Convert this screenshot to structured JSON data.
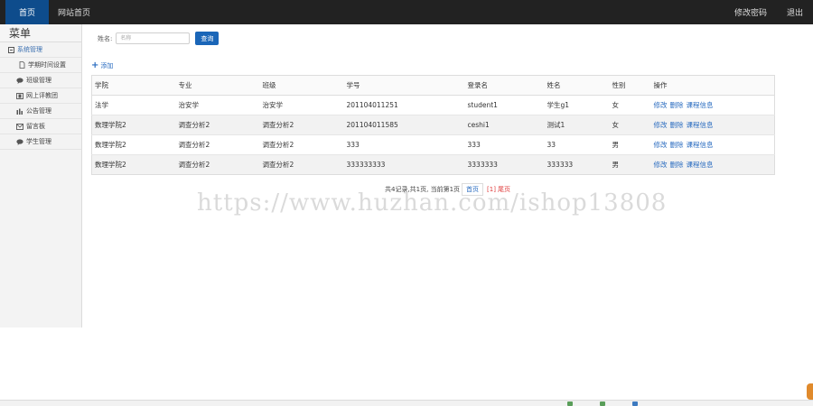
{
  "navbar": {
    "home": "首页",
    "site_home": "网站首页",
    "change_password": "修改密码",
    "logout": "退出"
  },
  "sidebar": {
    "title": "菜单",
    "group": "系统管理",
    "items": [
      {
        "label": "学期时间设置",
        "icon": "page-icon"
      },
      {
        "label": "班级管理",
        "icon": "comment-icon"
      },
      {
        "label": "网上评教团",
        "icon": "film-icon"
      },
      {
        "label": "公告管理",
        "icon": "bars-icon"
      },
      {
        "label": "留言板",
        "icon": "envelope-icon"
      },
      {
        "label": "学生管理",
        "icon": "comment-icon"
      }
    ]
  },
  "search": {
    "label": "姓名:",
    "placeholder": "名称",
    "button": "查询"
  },
  "add_label": "添加",
  "table": {
    "headers": [
      "学院",
      "专业",
      "班级",
      "学号",
      "登录名",
      "姓名",
      "性别",
      "操作"
    ],
    "rows": [
      [
        "法学",
        "治安学",
        "治安学",
        "201104011251",
        "student1",
        "学生g1",
        "女"
      ],
      [
        "数理学院2",
        "调查分析2",
        "调查分析2",
        "201104011585",
        "ceshi1",
        "测试1",
        "女"
      ],
      [
        "数理学院2",
        "调查分析2",
        "调查分析2",
        "333",
        "333",
        "33",
        "男"
      ],
      [
        "数理学院2",
        "调查分析2",
        "调查分析2",
        "333333333",
        "3333333",
        "333333",
        "男"
      ]
    ],
    "actions": [
      "修改",
      "删除",
      "课程信息"
    ]
  },
  "pager": {
    "summary": "共4记录,共1页, 当前第1页",
    "first": "首页",
    "current": "[1]",
    "last": "尾页"
  },
  "watermark": "https://www.huzhan.com/ishop13808",
  "colors": {
    "navbar": "#222222",
    "active_tab": "#0e4c8c",
    "primary_button": "#1a66b8",
    "link": "#2a6cc0"
  }
}
